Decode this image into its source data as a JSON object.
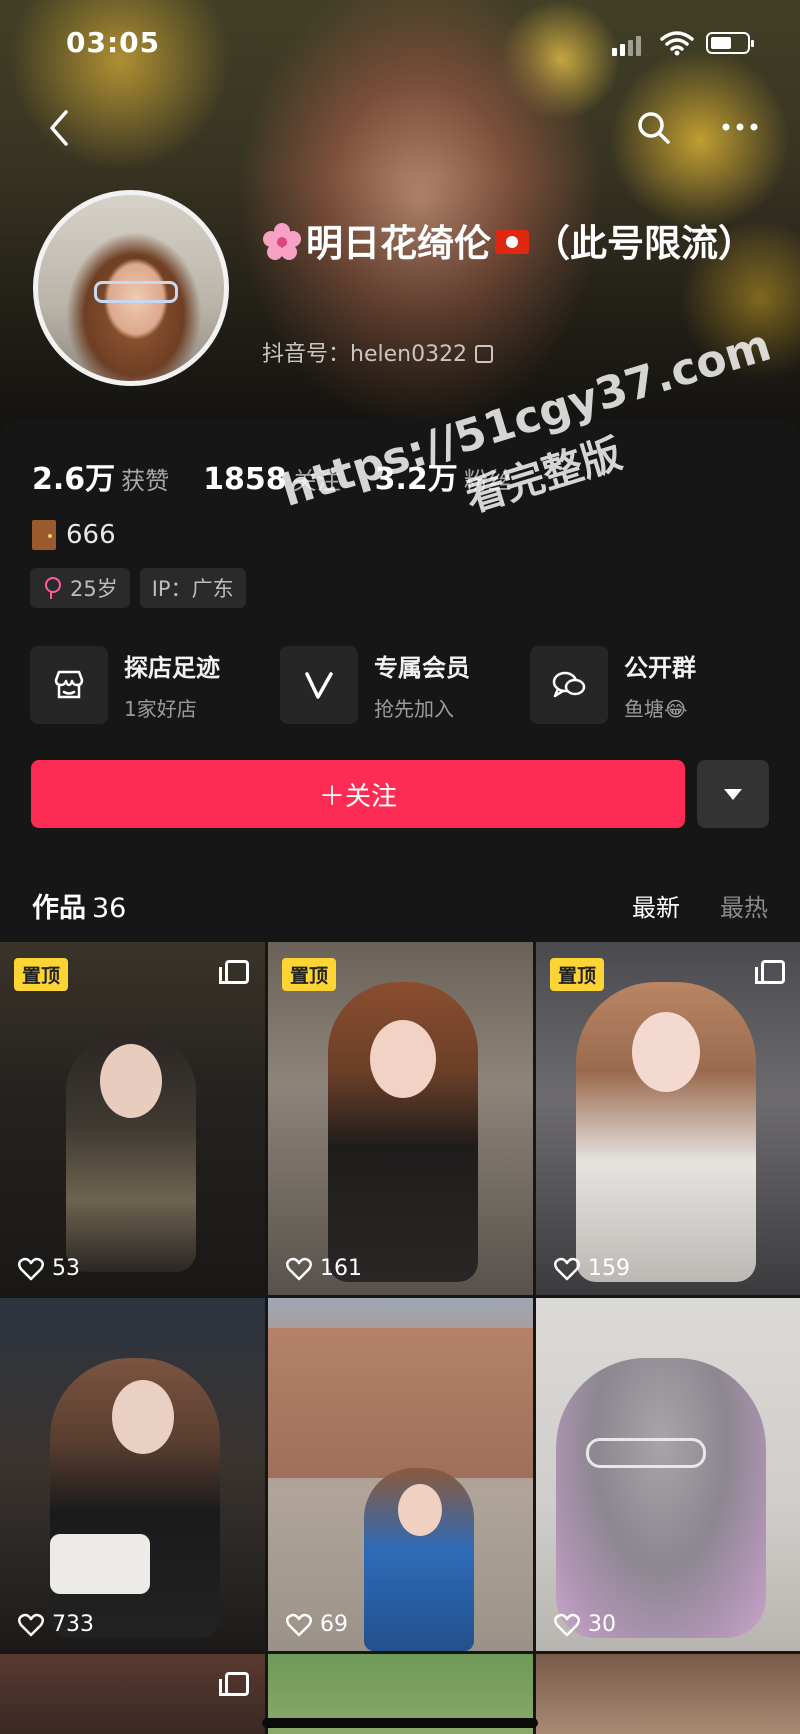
{
  "status_bar": {
    "time": "03:05"
  },
  "profile": {
    "name": "明日花绮伦",
    "name_suffix": "（此号限流）",
    "account_id": "抖音号：helen0322"
  },
  "stats": [
    {
      "value": "2.6万",
      "label": "获赞"
    },
    {
      "value": "1858",
      "label": "关注"
    },
    {
      "value": "3.2万",
      "label": "粉丝"
    }
  ],
  "bio": "666",
  "tags": {
    "age": "25岁",
    "ip": "IP：广东"
  },
  "features": [
    {
      "title": "探店足迹",
      "subtitle": "1家好店",
      "icon": "store-icon"
    },
    {
      "title": "专属会员",
      "subtitle": "抢先加入",
      "icon": "v-badge-icon"
    },
    {
      "title": "公开群",
      "subtitle": "鱼塘😂",
      "icon": "chat-icon"
    }
  ],
  "follow_label": "＋关注",
  "works": {
    "label": "作品",
    "count": "36",
    "sort_latest": "最新",
    "sort_hot": "最热",
    "pin_label": "置顶",
    "items": [
      {
        "likes": "53",
        "pinned": true,
        "multi": true
      },
      {
        "likes": "161",
        "pinned": true,
        "multi": false
      },
      {
        "likes": "159",
        "pinned": true,
        "multi": true
      },
      {
        "likes": "733",
        "pinned": false,
        "multi": false
      },
      {
        "likes": "69",
        "pinned": false,
        "multi": false
      },
      {
        "likes": "30",
        "pinned": false,
        "multi": false
      }
    ]
  },
  "watermark": {
    "url": "https://51cgy37.com",
    "note": "看完整版"
  },
  "colors": {
    "accent": "#fe2c55",
    "pin": "#fcd535",
    "background": "#161616"
  }
}
